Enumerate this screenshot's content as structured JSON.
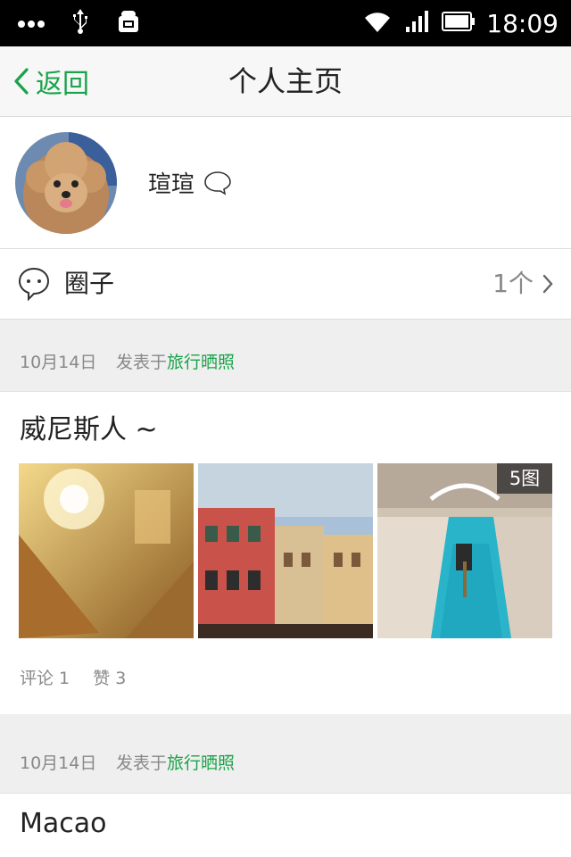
{
  "status_bar": {
    "time": "18:09",
    "left_icons": [
      "more-dots-icon",
      "usb-icon",
      "android-debug-icon"
    ],
    "right_icons": [
      "wifi-icon",
      "signal-icon",
      "battery-icon"
    ]
  },
  "header": {
    "back_label": "返回",
    "title": "个人主页",
    "accent_color": "#1aa34a"
  },
  "profile": {
    "username": "瑄瑄",
    "avatar": "dog-avatar"
  },
  "circle": {
    "label": "圈子",
    "count": "1个"
  },
  "posts": [
    {
      "date": "10月14日",
      "posted_in": "发表于",
      "topic": "旅行晒照",
      "title": "威尼斯人 ~",
      "photos": [
        "ornate-chandelier-photo",
        "colorful-buildings-photo",
        "venice-canal-gondola-photo"
      ],
      "photo_count": "5图",
      "comments": "评论 1",
      "likes": "赞 3"
    },
    {
      "date": "10月14日",
      "posted_in": "发表于",
      "topic": "旅行晒照",
      "title": "Macao"
    }
  ]
}
